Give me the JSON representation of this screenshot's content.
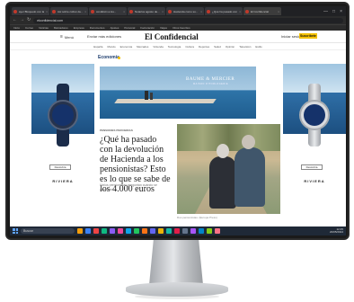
{
  "browser": {
    "tabs": [
      {
        "label": "ayer Bloquedo con la..."
      },
      {
        "label": "Así sobre cofren de..."
      },
      {
        "label": "condición a los..."
      },
      {
        "label": "Notarios agosto de..."
      },
      {
        "label": "Hacienda como su..."
      },
      {
        "label": "¿Qué ha pasado con..."
      },
      {
        "label": "El Confidencial"
      }
    ],
    "tab_close": "×",
    "url": "elconfidencial.com",
    "bookmarks": [
      "Inicio",
      "Correo",
      "Noticias",
      "Marcadores",
      "Empresa",
      "Documentos",
      "Ajustes",
      "Personal",
      "Facturación",
      "Viajes",
      "Otros favoritos"
    ]
  },
  "site": {
    "menu_label": "Menú",
    "edition_label": "Enviar más ediciones",
    "logo": "El Confidencial",
    "login_label": "Iniciar sesión",
    "subscribe_label": "Suscríbete",
    "sections": [
      "España",
      "Mundo",
      "Economía",
      "Mercados",
      "Vivienda",
      "Tecnología",
      "Cultura",
      "Deportes",
      "Salud",
      "Opinión",
      "Televisión",
      "Estilo"
    ],
    "section_title": "Economía"
  },
  "ads": {
    "left_cta": "Descubra",
    "left_brand": "RIVIERA",
    "right_cta": "Descubra",
    "right_brand": "RIVIERA",
    "banner_brand": "BAUME & MERCIER",
    "banner_sub": "MAISON D'HORLOGERIE"
  },
  "article": {
    "kicker": "PENSIONES PERCIBIDAS",
    "headline": "¿Qué ha pasado con la devolución de Hacienda a los pensionistas? Esto es lo que se sabe de los 4.000 euros",
    "summary": "Varios pensionistas preguntan cuándo se devolverá",
    "caption": "Dos pensionistas. (Europa Press)"
  },
  "taskbar": {
    "search_placeholder": "Buscar",
    "time": "12:45",
    "date": "20/05/2024",
    "icon_colors": [
      "#f59e0b",
      "#3b82f6",
      "#ef4444",
      "#10b981",
      "#8b5cf6",
      "#ec4899",
      "#0ea5e9",
      "#22c55e",
      "#f97316",
      "#6366f1",
      "#eab308",
      "#14b8a6",
      "#e11d48",
      "#64748b",
      "#a855f7",
      "#0284c7",
      "#84cc16",
      "#fb7185"
    ]
  },
  "window_controls": {
    "minimize": "—",
    "maximize": "□",
    "close": "×"
  },
  "nav": {
    "back": "←",
    "forward": "→",
    "reload": "↻"
  },
  "colors": {
    "accent_yellow": "#f5c200",
    "section_blue": "#1a3a6b"
  }
}
